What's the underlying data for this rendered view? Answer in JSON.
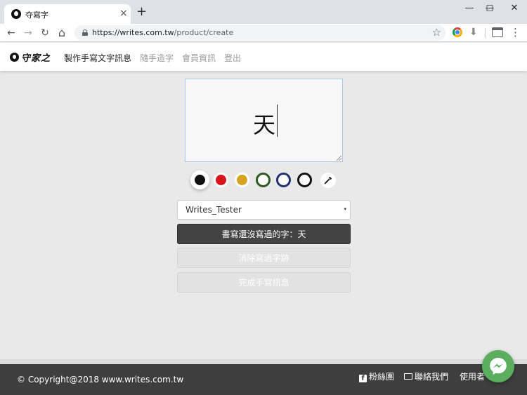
{
  "browser": {
    "tab_title": "夺寫字",
    "tab_close": "×",
    "new_tab": "+",
    "window_controls": {
      "minimize": "—",
      "maximize": "☐",
      "close": "✕"
    },
    "nav": {
      "back": "←",
      "forward": "→",
      "reload": "↻",
      "home": "⌂"
    },
    "url_host": "https://writes.com.tw",
    "url_path": "/product/create",
    "bookmark_star": "☆",
    "menu": "⋮"
  },
  "header": {
    "logo_text": "守家之",
    "nav": [
      {
        "label": "製作手寫文字訊息",
        "state": "active"
      },
      {
        "label": "隨手造字",
        "state": "muted"
      },
      {
        "label": "會員資訊",
        "state": "muted"
      },
      {
        "label": "登出",
        "state": "muted"
      }
    ]
  },
  "editor": {
    "value": "天"
  },
  "colors": {
    "swatches": [
      {
        "name": "black",
        "hex": "#111111",
        "style": "filled",
        "selected": true
      },
      {
        "name": "red",
        "hex": "#d9141b",
        "style": "filled",
        "selected": false
      },
      {
        "name": "gold",
        "hex": "#d8a323",
        "style": "filled",
        "selected": false
      },
      {
        "name": "green",
        "hex": "#2f5a22",
        "style": "ring",
        "selected": false
      },
      {
        "name": "navy",
        "hex": "#1e3370",
        "style": "ring",
        "selected": false
      },
      {
        "name": "black-outline",
        "hex": "#111111",
        "style": "ring",
        "selected": false
      }
    ],
    "eyedropper_icon": "eyedropper-icon",
    "footer_bg": "#3e3e3e",
    "primary_button": "#434343",
    "messenger": "#5aae5e"
  },
  "font_select": {
    "value": "Writes_Tester",
    "caret": "▾"
  },
  "buttons": {
    "write_missing": "書寫還沒寫過的字：天",
    "clear_strokes": "消除寫過字跡",
    "finish_message": "完成手寫訊息"
  },
  "footer": {
    "copyright": "© Copyright@2018 www.writes.com.tw",
    "fb_icon": "f",
    "links": [
      {
        "label": "粉絲團",
        "icon": "facebook-icon"
      },
      {
        "label": "聯絡我們",
        "icon": "mail-icon"
      },
      {
        "label": "使用者",
        "icon": ""
      }
    ]
  }
}
